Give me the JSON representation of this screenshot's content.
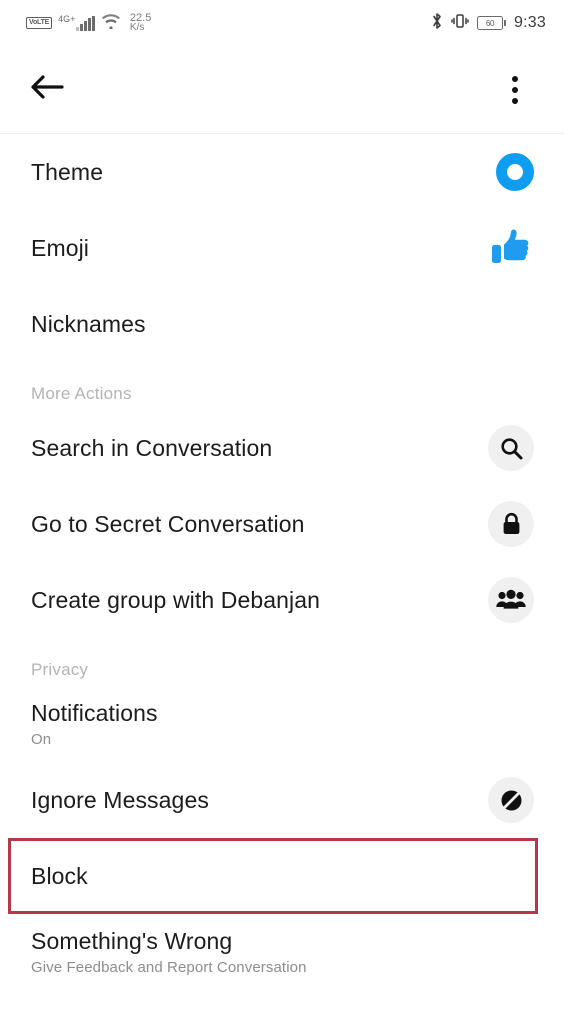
{
  "status_bar": {
    "volte_label": "VoLTE",
    "network_type": "4G+",
    "wifi_icon": "wifi-icon",
    "network_speed_value": "22.5",
    "network_speed_unit": "K/s",
    "bluetooth_icon": "bluetooth-icon",
    "vibrate_icon": "vibrate-icon",
    "battery_level": "60",
    "time": "9:33"
  },
  "toolbar": {
    "back_icon": "back-arrow-icon",
    "overflow_icon": "overflow-menu-icon"
  },
  "list": [
    {
      "type": "item",
      "name": "theme",
      "title": "Theme",
      "sub": null,
      "icon": "theme-color-circle-icon"
    },
    {
      "type": "item",
      "name": "emoji",
      "title": "Emoji",
      "sub": null,
      "icon": "thumbs-up-icon"
    },
    {
      "type": "item",
      "name": "nicknames",
      "title": "Nicknames",
      "sub": null,
      "icon": null
    },
    {
      "type": "header",
      "name": "more-actions",
      "title": "More Actions"
    },
    {
      "type": "item",
      "name": "search-in-conversation",
      "title": "Search in Conversation",
      "sub": null,
      "icon": "search-icon"
    },
    {
      "type": "item",
      "name": "go-to-secret-conversation",
      "title": "Go to Secret Conversation",
      "sub": null,
      "icon": "lock-icon"
    },
    {
      "type": "item",
      "name": "create-group",
      "title": "Create group with Debanjan",
      "sub": null,
      "icon": "group-icon"
    },
    {
      "type": "header",
      "name": "privacy",
      "title": "Privacy"
    },
    {
      "type": "item",
      "name": "notifications",
      "title": "Notifications",
      "sub": "On",
      "icon": null
    },
    {
      "type": "item",
      "name": "ignore-messages",
      "title": "Ignore Messages",
      "sub": null,
      "icon": "ignore-slash-icon"
    },
    {
      "type": "item",
      "name": "block",
      "title": "Block",
      "sub": null,
      "icon": null,
      "highlighted": true
    },
    {
      "type": "item",
      "name": "somethings-wrong",
      "title": "Something's Wrong",
      "sub": "Give Feedback and Report Conversation",
      "icon": null
    }
  ],
  "colors": {
    "accent_blue": "#0f9df2",
    "highlight_red": "#b5384a",
    "badge_gray": "#f0f0f0",
    "section_header_gray": "#b4b4b4",
    "subtitle_gray": "#8d8d8d",
    "title_black": "#1c1c1c"
  }
}
